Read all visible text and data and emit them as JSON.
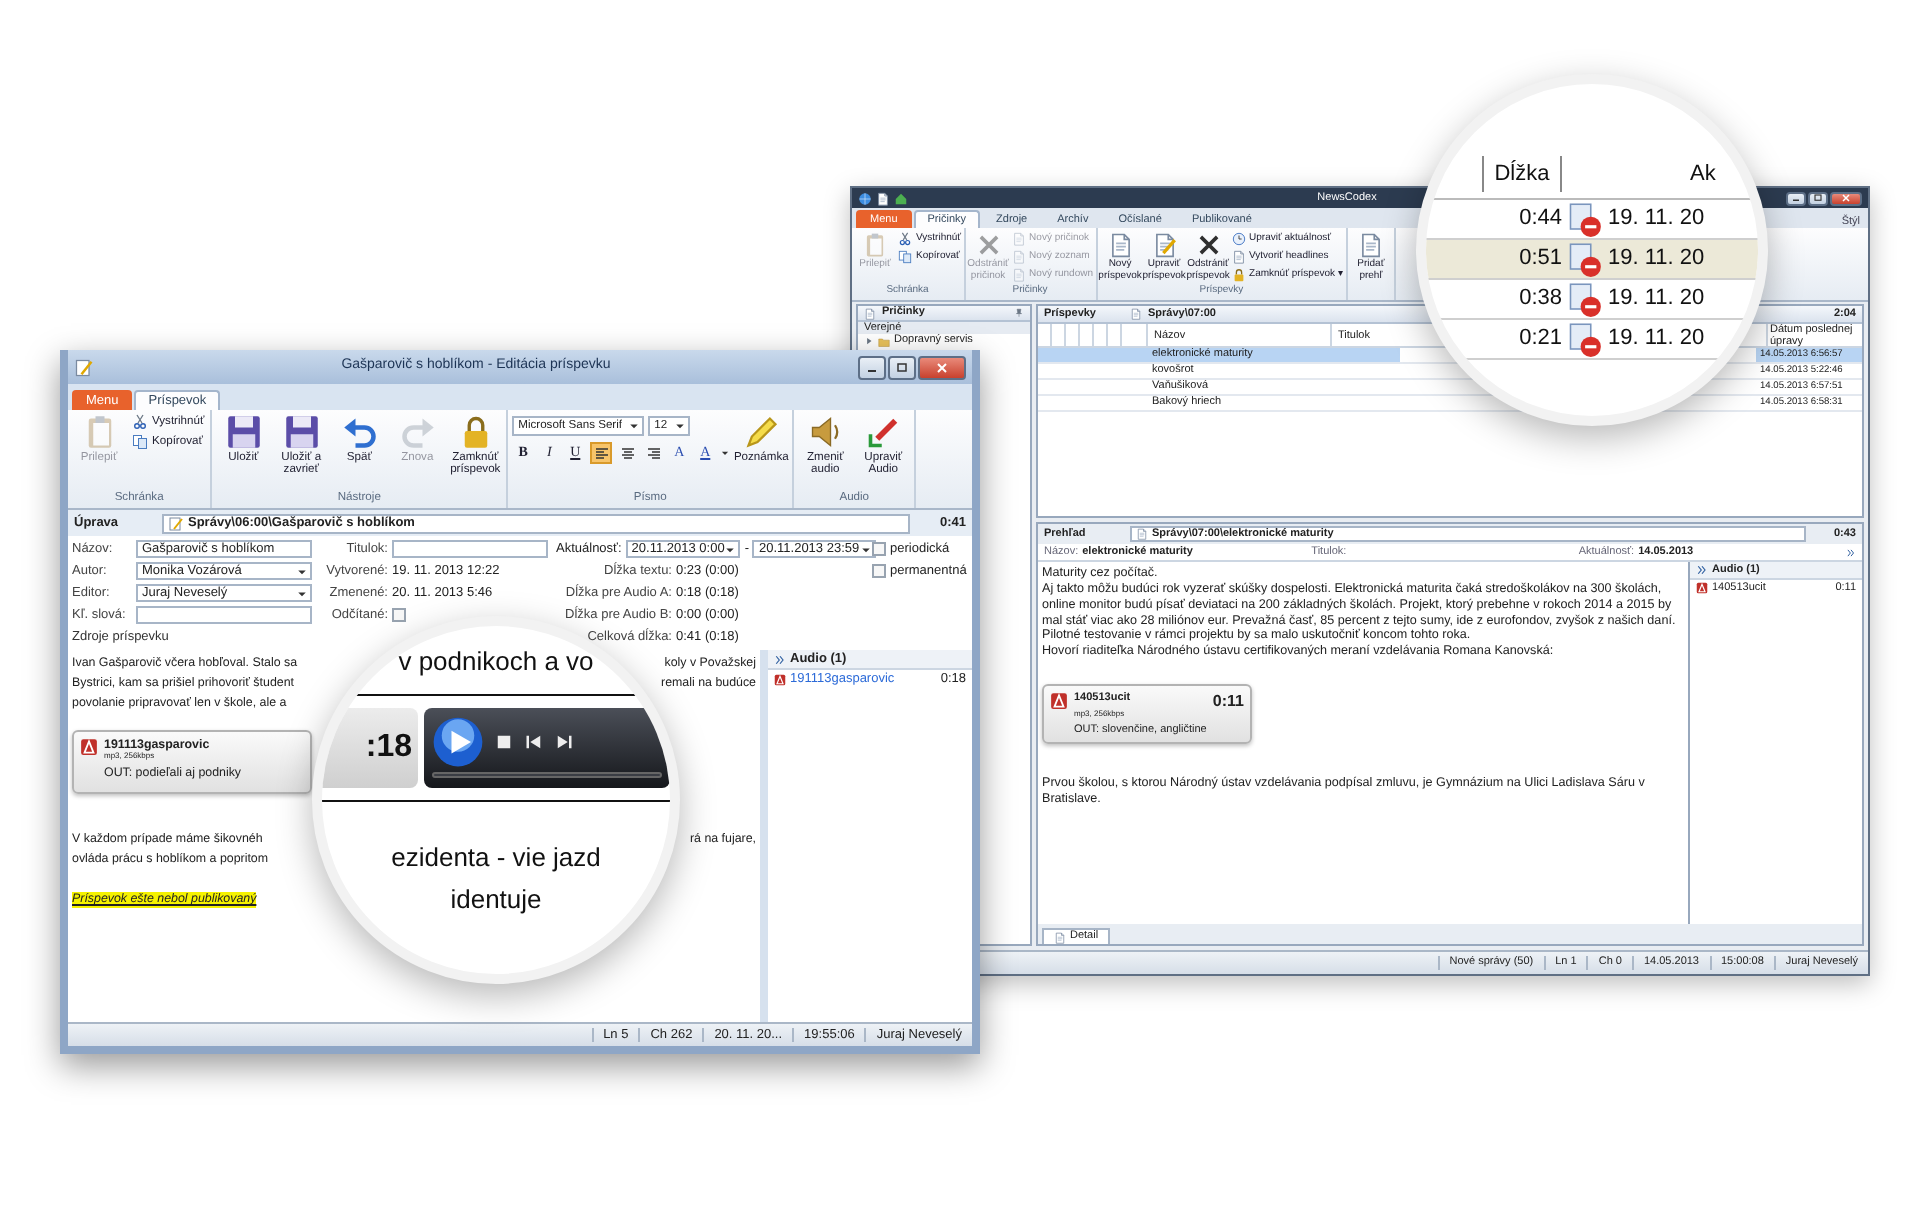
{
  "back_window": {
    "title": "NewsCodex",
    "tabs": [
      {
        "label": "Menu",
        "kind": "menu",
        "selected": false
      },
      {
        "label": "Pričinky",
        "selected": true
      },
      {
        "label": "Zdroje",
        "selected": false
      },
      {
        "label": "Archív",
        "selected": false
      },
      {
        "label": "Očíslané",
        "selected": false
      },
      {
        "label": "Publikované",
        "selected": false
      }
    ],
    "style_menu": "Štýl",
    "ribbon_groups": [
      {
        "label": "Schránka",
        "buttons": [
          {
            "label": "Prilepiť",
            "kind": "large",
            "disabled": true
          },
          {
            "label": "Vystrihnúť",
            "kind": "small",
            "disabled": false
          },
          {
            "label": "Kopírovať",
            "kind": "small",
            "disabled": false
          }
        ]
      },
      {
        "label": "Pričinky",
        "buttons": [
          {
            "label": "Odstrániť pričinok",
            "kind": "large",
            "disabled": true
          },
          {
            "label": "Nový pričinok",
            "kind": "small",
            "disabled": true
          },
          {
            "label": "Nový zoznam",
            "kind": "small",
            "disabled": true
          },
          {
            "label": "Nový rundown",
            "kind": "small",
            "disabled": true
          }
        ]
      },
      {
        "label": "Príspevky",
        "buttons": [
          {
            "label": "Nový príspevok",
            "kind": "large",
            "disabled": false
          },
          {
            "label": "Upraviť príspevok",
            "kind": "large",
            "disabled": false
          },
          {
            "label": "Odstrániť príspevok",
            "kind": "large",
            "disabled": false
          },
          {
            "label": "Upraviť aktuálnosť",
            "kind": "small",
            "disabled": false
          },
          {
            "label": "Vytvoriť headlines",
            "kind": "small",
            "disabled": false
          },
          {
            "label": "Zamknúť príspevok ▾",
            "kind": "small",
            "disabled": false
          }
        ]
      },
      {
        "buttons": [
          {
            "label": "Pridať prehľ",
            "kind": "large",
            "disabled": false
          }
        ]
      }
    ],
    "folders": {
      "title": "Pričinky",
      "section": "Verejné",
      "items": [
        {
          "label": "Dopravný servis",
          "expanded": false
        }
      ]
    },
    "posts": {
      "title": "Príspevky",
      "path": "Správy\\07:00",
      "total": "2:04",
      "columns": [
        "Názov",
        "Titulok",
        "Dátum poslednej úpravy"
      ],
      "rows": [
        {
          "title": "elektronické maturity",
          "modified": "14.05.2013 6:56:57",
          "selected": true
        },
        {
          "title": "kovošrot",
          "modified": "14.05.2013 5:22:46",
          "selected": false
        },
        {
          "title": "Vaňušiková",
          "modified": "14.05.2013 6:57:51",
          "selected": false
        },
        {
          "title": "Bakový hriech",
          "modified": "14.05.2013 6:58:31",
          "selected": false
        }
      ]
    },
    "preview": {
      "label": "Prehľad",
      "path": "Správy\\07:00\\elektronické maturity",
      "duration": "0:43",
      "fields": [
        {
          "label": "Názov:",
          "value": "elektronické maturity"
        },
        {
          "label": "Titulok:"
        },
        {
          "label": "Aktuálnosť:",
          "value": "14.05.2013"
        }
      ],
      "paragraphs": [
        "Maturity cez počítač.",
        "Aj takto môžu budúci rok vyzerať skúšky dospelosti. Elektronická maturita čaká stredoškolákov na 300 školách, online monitor budú písať deviataci na 200 základných školách. Projekt, ktorý prebehne v rokoch 2014 a 2015 by mal stáť viac ako 28 miliónov eur. Prevažná časť, 85 percent z tejto sumy, ide z eurofondov, zvyšok z našich daní. Pilotné testovanie v rámci projektu by sa malo uskutočniť koncom tohto roka.",
        "Hovorí riaditeľka Národného ústavu certifikovaných meraní vzdelávania Romana Kanovská:"
      ],
      "audio_card": {
        "name": "140513ucit",
        "format": "mp3, 256kbps",
        "duration": "0:11",
        "out": "OUT: slovenčine, angličtine"
      },
      "after_text": "Prvou školou, s ktorou Národný ústav vzdelávania podpísal zmluvu, je Gymnázium na Ulici Ladislava Sáru v Bratislave.",
      "audio_panel": {
        "title": "Audio (1)",
        "items": [
          {
            "name": "140513ucit",
            "duration": "0:11"
          }
        ]
      },
      "bottom_tab": "Detail"
    },
    "status_bar": [
      "Nové správy (50)",
      "Ln 1",
      "Ch 0",
      "14.05.2013",
      "15:00:08",
      "Juraj Neveselý"
    ]
  },
  "front_window": {
    "title": "Gašparovič s hoblíkom - Editácia príspevku",
    "tabs": [
      {
        "label": "Menu",
        "kind": "menu",
        "selected": false
      },
      {
        "label": "Príspevok",
        "selected": true
      }
    ],
    "ribbon_groups": [
      {
        "label": "Schránka",
        "buttons": [
          {
            "label": "Prilepiť",
            "kind": "large",
            "disabled": true
          },
          {
            "label": "Vystrihnúť",
            "kind": "small",
            "disabled": false
          },
          {
            "label": "Kopírovať",
            "kind": "small",
            "disabled": false
          }
        ]
      },
      {
        "label": "Nástroje",
        "buttons": [
          {
            "label": "Uložiť",
            "kind": "large",
            "disabled": false
          },
          {
            "label": "Uložiť a zavrieť",
            "kind": "large",
            "disabled": false
          },
          {
            "label": "Späť",
            "kind": "large",
            "disabled": false
          },
          {
            "label": "Znova",
            "kind": "large",
            "disabled": true
          },
          {
            "label": "Zamknúť príspevok",
            "kind": "large",
            "disabled": false
          }
        ]
      },
      {
        "label": "Písmo",
        "kind": "font",
        "font": "Microsoft Sans Serif",
        "size": "12",
        "styles": [
          "B",
          "I",
          "U"
        ],
        "alignment": [
          {
            "selected": true
          },
          {
            "selected": false
          },
          {
            "selected": false
          }
        ],
        "colors": [
          "A",
          "A"
        ],
        "buttons": [
          {
            "label": "Poznámka",
            "kind": "large",
            "disabled": false
          }
        ]
      },
      {
        "label": "Audio",
        "buttons": [
          {
            "label": "Zmeniť audio",
            "kind": "large",
            "disabled": false
          },
          {
            "label": "Upraviť Audio",
            "kind": "large",
            "disabled": false
          }
        ]
      }
    ],
    "header": {
      "label": "Úprava",
      "path": "Správy\\06:00\\Gašparovič s hoblíkom",
      "duration": "0:41"
    },
    "form": {
      "left": [
        {
          "label": "Názov:",
          "value": "Gašparovič s hoblíkom",
          "kind": "text"
        },
        {
          "label": "Autor:",
          "value": "Monika Vozárová",
          "kind": "dropdown"
        },
        {
          "label": "Editor:",
          "value": "Juraj Neveselý",
          "kind": "dropdown"
        },
        {
          "label": "Kľ. slová:",
          "kind": "text"
        }
      ],
      "sources_link": "Zdroje príspevku",
      "middle": [
        {
          "label": "Titulok:",
          "kind": "text"
        },
        {
          "label": "Vytvorené:",
          "value": "19. 11. 2013  12:22",
          "kind": "static"
        },
        {
          "label": "Zmenené:",
          "value": "20. 11. 2013  5:46",
          "kind": "static"
        },
        {
          "label": "Odčítané:",
          "kind": "checkbox",
          "checked": false
        }
      ],
      "validity": {
        "label": "Aktuálnosť:",
        "from": "20.11.2013 0:00",
        "separator": "-",
        "to": "20.11.2013 23:59"
      },
      "options": [
        {
          "label": "periodická",
          "checked": false
        },
        {
          "label": "permanentná",
          "checked": false
        }
      ],
      "lengths": [
        {
          "label": "Dĺžka textu:",
          "value": "0:23 (0:00)"
        },
        {
          "label": "Dĺžka pre Audio A:",
          "value": "0:18 (0:18)"
        },
        {
          "label": "Dĺžka pre Audio B:",
          "value": "0:00 (0:00)"
        },
        {
          "label": "Celková dĺžka:",
          "value": "0:41 (0:18)"
        }
      ]
    },
    "body": [
      {
        "kind": "text",
        "lines": [
          {
            "left": "Ivan Gašparovič včera hobľoval. Stalo sa",
            "right": "koly v Považskej"
          },
          {
            "left": "Bystrici, kam sa prišiel prihovoriť študent",
            "right": "remali na budúce"
          },
          {
            "left": "povolanie pripravovať len v škole, ale a"
          }
        ]
      },
      {
        "kind": "audio",
        "name": "191113gasparovic",
        "format": "mp3, 256kbps",
        "out": "OUT: podieľali aj podniky"
      },
      {
        "kind": "text",
        "lines": [
          {
            "left": "V každom prípade máme šikovnéh",
            "right": "rá na fujare,"
          },
          {
            "left": "ovláda prácu s hoblíkom a popritom"
          }
        ]
      },
      {
        "kind": "note",
        "text": "Príspevok ešte nebol publikovaný"
      }
    ],
    "audio_panel": {
      "title": "Audio (1)",
      "items": [
        {
          "name": "191113gasparovic",
          "duration": "0:18"
        }
      ]
    },
    "status_bar": [
      "Ln 5",
      "Ch 262",
      "20. 11. 20...",
      "19:55:06",
      "Juraj Neveselý"
    ]
  },
  "magnifier_list": {
    "columns": [
      "Dĺžka",
      "Ak"
    ],
    "rows": [
      {
        "duration": "0:44",
        "date": "19. 11. 20",
        "selected": false
      },
      {
        "duration": "0:51",
        "date": "19. 11. 20",
        "selected": true
      },
      {
        "duration": "0:38",
        "date": "19. 11. 20",
        "selected": false
      },
      {
        "duration": "0:21",
        "date": "19. 11. 20",
        "selected": false
      }
    ]
  },
  "magnifier_player": {
    "text_above": "v podnikoch a vo",
    "duration": ":18",
    "text_below": [
      "ezidenta - vie jazd",
      "identuje"
    ]
  }
}
